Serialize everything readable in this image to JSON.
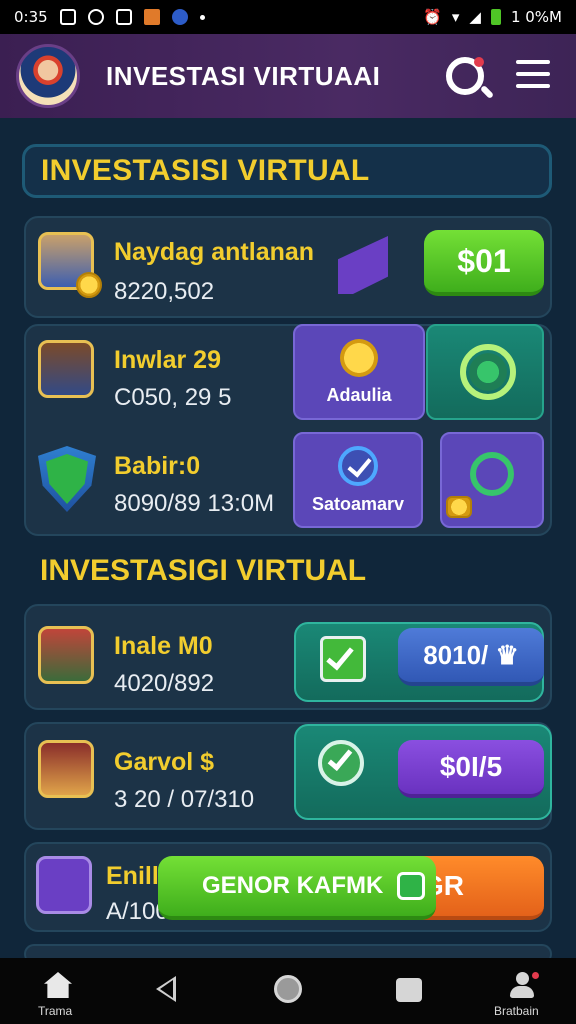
{
  "status_bar": {
    "time": "0:35",
    "right_text": "1 0%M"
  },
  "header": {
    "title": "INVESTASI VIRTUAAI"
  },
  "section1": {
    "title": "INVESTASISI VIRTUAL"
  },
  "items": [
    {
      "name": "Naydag antlanan",
      "value": "8220,502",
      "action_label": "$01"
    },
    {
      "name": "Inwlar 29",
      "value": "C050, 29 5",
      "tile_label": "Adaulia"
    },
    {
      "name": "Babir:0",
      "value": "8090/89 13:0M",
      "tile_label": "Satoamarv"
    }
  ],
  "section2": {
    "title": "INVESTASIGI VIRTUAL"
  },
  "items2": [
    {
      "name": "Inale M0",
      "value": "4020/892",
      "button_label": "8010/ ♛"
    },
    {
      "name": "Garvol $",
      "value": "3 20 / 07/310",
      "button_label": "$0I/5"
    },
    {
      "name": "Enill",
      "value": "A/100",
      "overlay_label": "GENOR KAFMK",
      "orange_label": "GR"
    }
  ],
  "bottom_nav": {
    "left_label": "Trama",
    "right_label": "Bratbain"
  },
  "colors": {
    "accent_yellow": "#f2cd2e",
    "header_purple": "#4a2a63",
    "green": "#4fc526",
    "purple": "#5b47b8",
    "teal": "#17796a"
  }
}
